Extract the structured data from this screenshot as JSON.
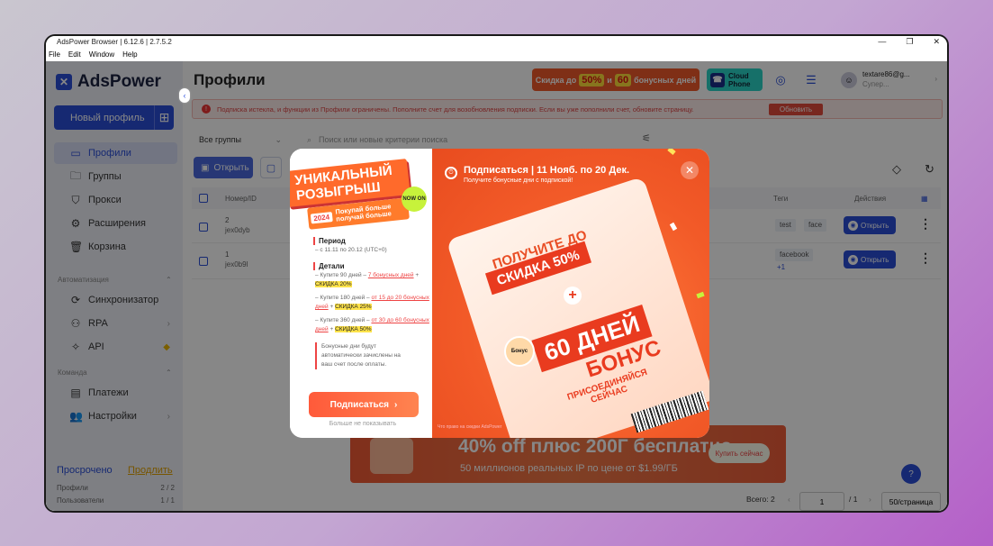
{
  "window": {
    "title": "AdsPower Browser | 6.12.6 | 2.7.5.2",
    "controls": [
      "—",
      "❐",
      "✕"
    ]
  },
  "menu": [
    "File",
    "Edit",
    "Window",
    "Help"
  ],
  "sidebar": {
    "logo": "AdsPower",
    "new_profile": "Новый профиль",
    "items": [
      {
        "label": "Профили",
        "icon": "▭"
      },
      {
        "label": "Группы",
        "icon": "🗀"
      },
      {
        "label": "Прокси",
        "icon": "⛉"
      },
      {
        "label": "Расширения",
        "icon": "⚙"
      },
      {
        "label": "Корзина",
        "icon": "🗑"
      }
    ],
    "automation_title": "Автоматизация",
    "automation": [
      {
        "label": "Синхронизатор",
        "icon": "⟳"
      },
      {
        "label": "RPA",
        "icon": "⚇"
      },
      {
        "label": "API",
        "icon": "✧"
      }
    ],
    "team_title": "Команда",
    "team": [
      {
        "label": "Платежи",
        "icon": "▤"
      },
      {
        "label": "Настройки",
        "icon": "👥"
      }
    ],
    "expired": "Просрочено",
    "renew": "Продлить",
    "stats": [
      {
        "label": "Профили",
        "value": "2 / 2"
      },
      {
        "label": "Пользователи",
        "value": "1 / 1"
      }
    ]
  },
  "main": {
    "title": "Профили",
    "promo": {
      "pre": "Скидка до",
      "a": "50%",
      "mid": "и",
      "b": "60",
      "c": "бонусных",
      "d": "дней"
    },
    "cloud": {
      "line1": "Cloud",
      "line2": "Phone"
    },
    "user": {
      "name": "textare86@g...",
      "role": "Супер..."
    },
    "alert": {
      "text": "Подписка истекла, и функции из Профили ограничены. Пополните счет для возобновления подписки. Если вы уже пополнили счет, обновите страницу.",
      "button": "Обновить"
    },
    "groups": "Все группы",
    "search_placeholder": "Поиск или новые критерии поиска",
    "open_btn": "Открыть",
    "headers": {
      "num": "Номер/ID",
      "tags": "Теги",
      "actions": "Действия"
    },
    "rows": [
      {
        "num": "2",
        "id": "jex0dyb",
        "tags": [
          "test",
          "face"
        ],
        "open": "Открыть"
      },
      {
        "num": "1",
        "id": "jex0b9l",
        "tags": [
          "facebook",
          "+1"
        ],
        "open": "Открыть"
      }
    ],
    "banner": {
      "a": "40% off плюс 200Г бесплатно",
      "b": "50 миллионов реальных IP по цене от $1.99/ГБ",
      "c": "Купить сейчас"
    },
    "pager": {
      "total": "Всего: 2",
      "page": "1",
      "of": "/ 1",
      "per": "50/страница"
    }
  },
  "modal": {
    "badge_line1": "УНИКАЛЬНЫЙ",
    "badge_line2": "РОЗЫГРЫШ",
    "year": "2024",
    "tagline": "Покупай больше получай больше",
    "now_on": "NOW ON",
    "period_h": "Период",
    "period_t": "– с 11.11 по 20.12 (UTC+0)",
    "details_h": "Детали",
    "d1_a": "– Купите 90 дней – ",
    "d1_b": "7 бонусных дней",
    "d1_c": " + ",
    "d1_d": "СКИДКА 20%",
    "d2_a": "– Купите 180 дней – ",
    "d2_b": "от 15 до 20 бонусных дней",
    "d2_c": " + ",
    "d2_d": "СКИДКА 25%",
    "d3_a": "– Купите 360 дней – ",
    "d3_b": "от 30 до 60 бонусных дней",
    "d3_c": " + ",
    "d3_d": "СКИДКА 50%",
    "note": "Бонусные дни будут автоматически зачислены на ваш счет после оплаты.",
    "subscribe": "Подписаться",
    "dont_show": "Больше не показывать",
    "r_title": "Подписаться | 11 Нояб. по 20 Дек.",
    "r_sub": "Получите бонусные дни с подпиской!",
    "r_get": "ПОЛУЧИТЕ ДО",
    "r_disc": "СКИДКА 50%",
    "r_days": "60 ДНЕЙ",
    "r_bonus": "БОНУС",
    "r_join": "ПРИСОЕДИНЯЙСЯ СЕЙЧАС",
    "r_badge": "Бонус",
    "r_disclaimer": "Что право на скидки AdsPower"
  }
}
